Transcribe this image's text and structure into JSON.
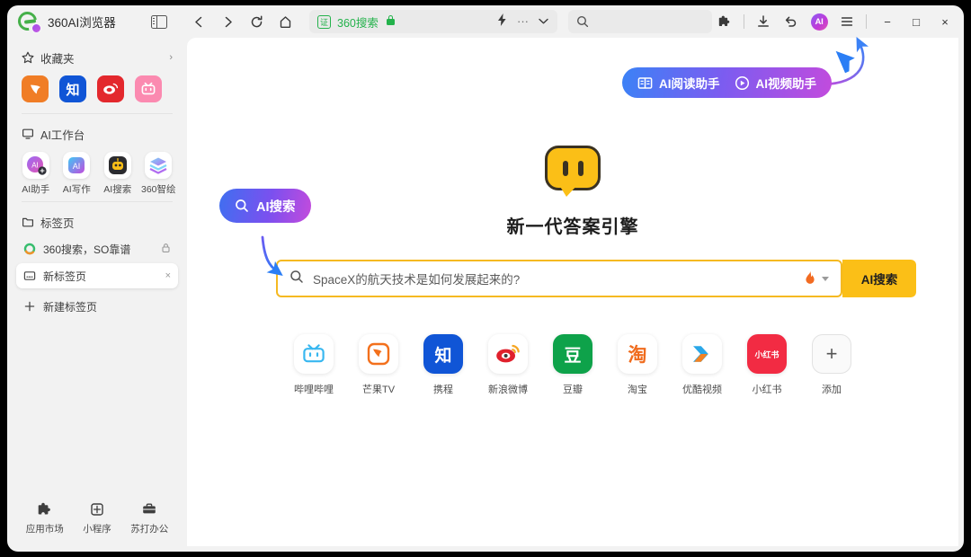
{
  "window": {
    "brand_title": "360AI浏览器",
    "controls": {
      "minimize": "−",
      "maximize": "□",
      "close": "×"
    }
  },
  "toolbar": {
    "back": "back-arrow",
    "forward": "forward-arrow",
    "reload": "reload",
    "home": "home",
    "address": {
      "cert_label": "证",
      "site": "360搜索",
      "lock": "lock-icon"
    },
    "boost": "lightning-icon",
    "more": "···",
    "collapse": "chevron-down",
    "search_placeholder": "",
    "extensions": "puzzle-icon",
    "downloads": "download-icon",
    "history": "undo-icon",
    "ai_badge": "AI",
    "menu": "hamburger-icon"
  },
  "sidebar": {
    "favorites": {
      "title": "收藏夹",
      "chevron": "›",
      "items": [
        {
          "name": "芒果TV",
          "glyph": "M",
          "color": "#f07d26"
        },
        {
          "name": "知乎",
          "glyph": "知",
          "color": "#1055d6"
        },
        {
          "name": "新浪微博",
          "glyph": "⊙",
          "color": "#e3282d"
        },
        {
          "name": "哔哩哔哩",
          "glyph": "▭",
          "color": "#fb8ab0"
        }
      ]
    },
    "workbench": {
      "title": "AI工作台",
      "items": [
        {
          "label": "AI助手",
          "icon": "ai-assistant-icon"
        },
        {
          "label": "AI写作",
          "icon": "ai-writing-icon"
        },
        {
          "label": "AI搜索",
          "icon": "ai-search-icon"
        },
        {
          "label": "360智绘",
          "icon": "ai-draw-icon"
        }
      ]
    },
    "tabs": {
      "title": "标签页",
      "items": [
        {
          "label": "360搜索，SO靠谱",
          "icon": "360-icon",
          "tail": "lock-icon",
          "active": false
        },
        {
          "label": "新标签页",
          "icon": "newtab-icon",
          "tail": "×",
          "active": true
        }
      ],
      "new_tab_label": "新建标签页",
      "new_tab_icon": "plus-icon"
    },
    "bottom": [
      {
        "label": "应用市场",
        "icon": "puzzle-icon"
      },
      {
        "label": "小程序",
        "icon": "miniprogram-icon"
      },
      {
        "label": "苏打办公",
        "icon": "briefcase-icon"
      }
    ]
  },
  "content": {
    "ai_assistants": [
      {
        "label": "AI阅读助手",
        "icon": "book-icon"
      },
      {
        "label": "AI视频助手",
        "icon": "play-circle-icon"
      }
    ],
    "hero": {
      "logo": "yellow-chat-bot-logo",
      "title": "新一代答案引擎"
    },
    "search": {
      "placeholder": "SpaceX的航天技术是如何发展起来的?",
      "value": "",
      "magnifier": "search-icon",
      "flame": "hot-icon",
      "caret": "chevron-down-icon",
      "button_label": "AI搜索"
    },
    "callout": {
      "label": "AI搜索",
      "icon": "search-icon"
    },
    "shortcuts": [
      {
        "label": "哔哩哔哩",
        "icon": "bilibili-icon"
      },
      {
        "label": "芒果TV",
        "icon": "mangotv-icon"
      },
      {
        "label": "携程",
        "icon": "zhihu-icon"
      },
      {
        "label": "新浪微博",
        "icon": "weibo-icon"
      },
      {
        "label": "豆瓣",
        "icon": "douban-icon"
      },
      {
        "label": "淘宝",
        "icon": "taobao-icon"
      },
      {
        "label": "优酷视频",
        "icon": "youku-icon"
      },
      {
        "label": "小红书",
        "icon": "xiaohongshu-icon"
      },
      {
        "label": "添加",
        "icon": "plus-icon"
      }
    ]
  },
  "colors": {
    "accent_yellow": "#fbbf17",
    "gradient_start": "#3b82f6",
    "gradient_end": "#c24bdd",
    "cert_green": "#23b24b",
    "cursor_blue": "#2b7ef5"
  }
}
